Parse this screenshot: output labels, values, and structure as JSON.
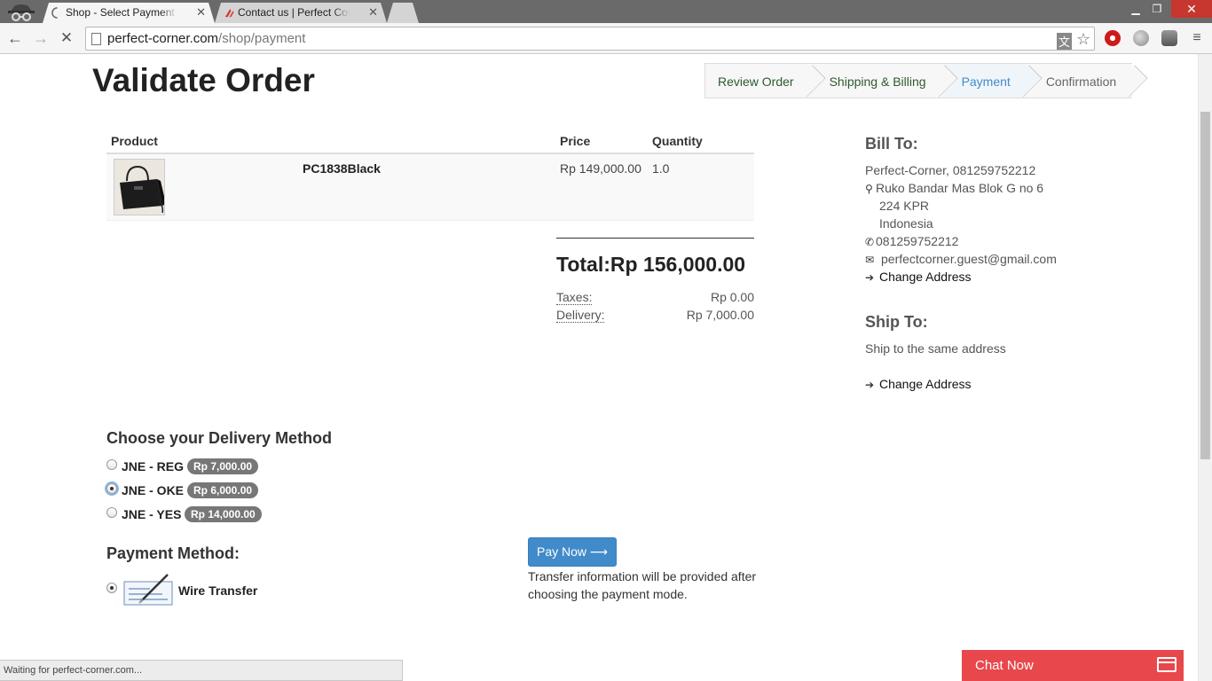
{
  "browser": {
    "tabs": [
      {
        "title": "Shop - Select Payment Mode",
        "active": true
      },
      {
        "title": "Contact us | Perfect Corner",
        "active": false
      }
    ],
    "url_host": "perfect-corner.com",
    "url_path": "/shop/payment",
    "status_text": "Waiting for perfect-corner.com..."
  },
  "page": {
    "title": "Validate Order",
    "wizard": [
      {
        "label": "Review Order",
        "state": "done"
      },
      {
        "label": "Shipping & Billing",
        "state": "done"
      },
      {
        "label": "Payment",
        "state": "current"
      },
      {
        "label": "Confirmation",
        "state": "todo"
      }
    ],
    "cart": {
      "headers": {
        "product": "Product",
        "price": "Price",
        "quantity": "Quantity"
      },
      "rows": [
        {
          "name": "PC1838Black",
          "price": "Rp 149,000.00",
          "quantity": "1.0"
        }
      ]
    },
    "totals": {
      "total_label": "Total:",
      "total_value": "Rp 156,000.00",
      "taxes_label": "Taxes:",
      "taxes_value": "Rp 0.00",
      "delivery_label": "Delivery:",
      "delivery_value": "Rp 7,000.00"
    },
    "delivery": {
      "heading": "Choose your Delivery Method",
      "options": [
        {
          "label": "JNE - REG",
          "price": "Rp 7,000.00",
          "checked": false
        },
        {
          "label": "JNE - OKE",
          "price": "Rp 6,000.00",
          "checked": true
        },
        {
          "label": "JNE - YES",
          "price": "Rp 14,000.00",
          "checked": false
        }
      ]
    },
    "payment": {
      "heading": "Payment Method:",
      "option_label": "Wire Transfer",
      "pay_button": "Pay Now",
      "note": "Transfer information will be provided after choosing the payment mode."
    },
    "bill_to": {
      "heading": "Bill To:",
      "name_line": "Perfect-Corner, 081259752212",
      "address_1": "Ruko Bandar Mas Blok G no 6",
      "address_2": "224 KPR",
      "country": "Indonesia",
      "phone": "081259752212",
      "email": "perfectcorner.guest@gmail.com",
      "change_link": "Change Address"
    },
    "ship_to": {
      "heading": "Ship To:",
      "text": "Ship to the same address",
      "change_link": "Change Address"
    },
    "chat": {
      "label": "Chat Now"
    }
  },
  "colors": {
    "primary": "#428bca",
    "badge": "#777777",
    "chat": "#e8474c"
  }
}
